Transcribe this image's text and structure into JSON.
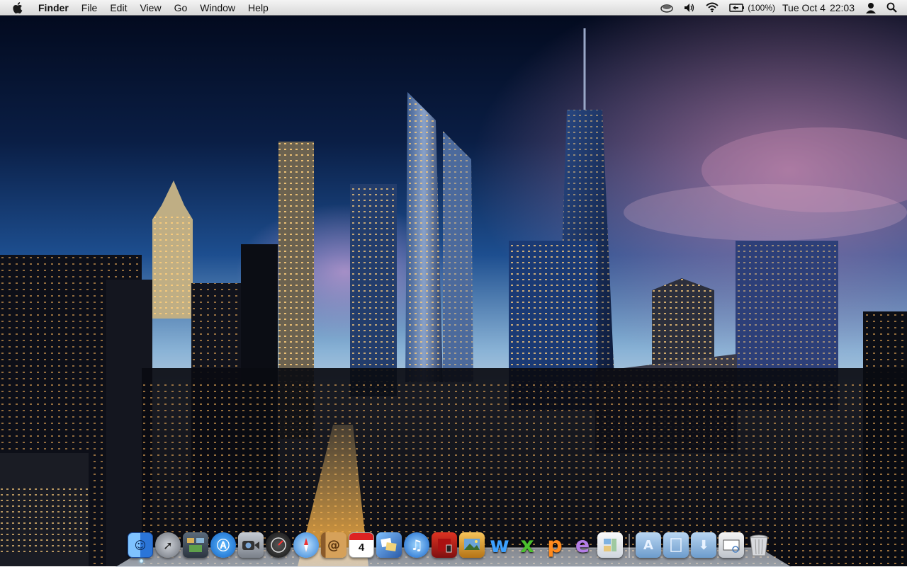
{
  "menubar": {
    "apple_icon": "apple-logo-icon",
    "app_name": "Finder",
    "menus": [
      "File",
      "Edit",
      "View",
      "Go",
      "Window",
      "Help"
    ],
    "status": {
      "battery_percent": "(100%)",
      "date": "Tue Oct 4",
      "time": "22:03"
    }
  },
  "dock": {
    "items": [
      {
        "name": "finder",
        "icon": "finder-icon",
        "running": true
      },
      {
        "name": "launchpad",
        "icon": "rocket-icon"
      },
      {
        "name": "mission-control",
        "icon": "mission-control-icon"
      },
      {
        "name": "app-store",
        "icon": "app-store-icon"
      },
      {
        "name": "facetime",
        "icon": "camera-icon"
      },
      {
        "name": "dashboard",
        "icon": "dashboard-gauge-icon"
      },
      {
        "name": "safari",
        "icon": "compass-icon"
      },
      {
        "name": "address-book",
        "icon": "address-book-icon"
      },
      {
        "name": "ical",
        "icon": "calendar-icon",
        "label": "4"
      },
      {
        "name": "iphoto",
        "icon": "photos-icon"
      },
      {
        "name": "itunes",
        "icon": "music-note-icon"
      },
      {
        "name": "photo-booth",
        "icon": "photo-booth-icon"
      },
      {
        "name": "image-capture",
        "icon": "image-capture-icon"
      },
      {
        "name": "word",
        "icon": "word-w-icon"
      },
      {
        "name": "excel",
        "icon": "excel-x-icon"
      },
      {
        "name": "powerpoint",
        "icon": "powerpoint-p-icon"
      },
      {
        "name": "entourage",
        "icon": "entourage-e-icon"
      },
      {
        "name": "system-preferences",
        "icon": "document-icon"
      },
      {
        "name": "applications-folder",
        "icon": "applications-folder-icon"
      },
      {
        "name": "documents-folder",
        "icon": "documents-folder-icon"
      },
      {
        "name": "downloads-folder",
        "icon": "downloads-folder-icon"
      },
      {
        "name": "preview",
        "icon": "preview-icon"
      },
      {
        "name": "trash",
        "icon": "trash-icon"
      }
    ]
  },
  "colors": {
    "menubar_top": "#f4f4f4",
    "menubar_bottom": "#d9d9d9",
    "sky_top": "#030a1e",
    "sky_mid": "#1b3d7a",
    "horizon_glow": "#e8c7d8",
    "window_light": "#ffd58a"
  }
}
